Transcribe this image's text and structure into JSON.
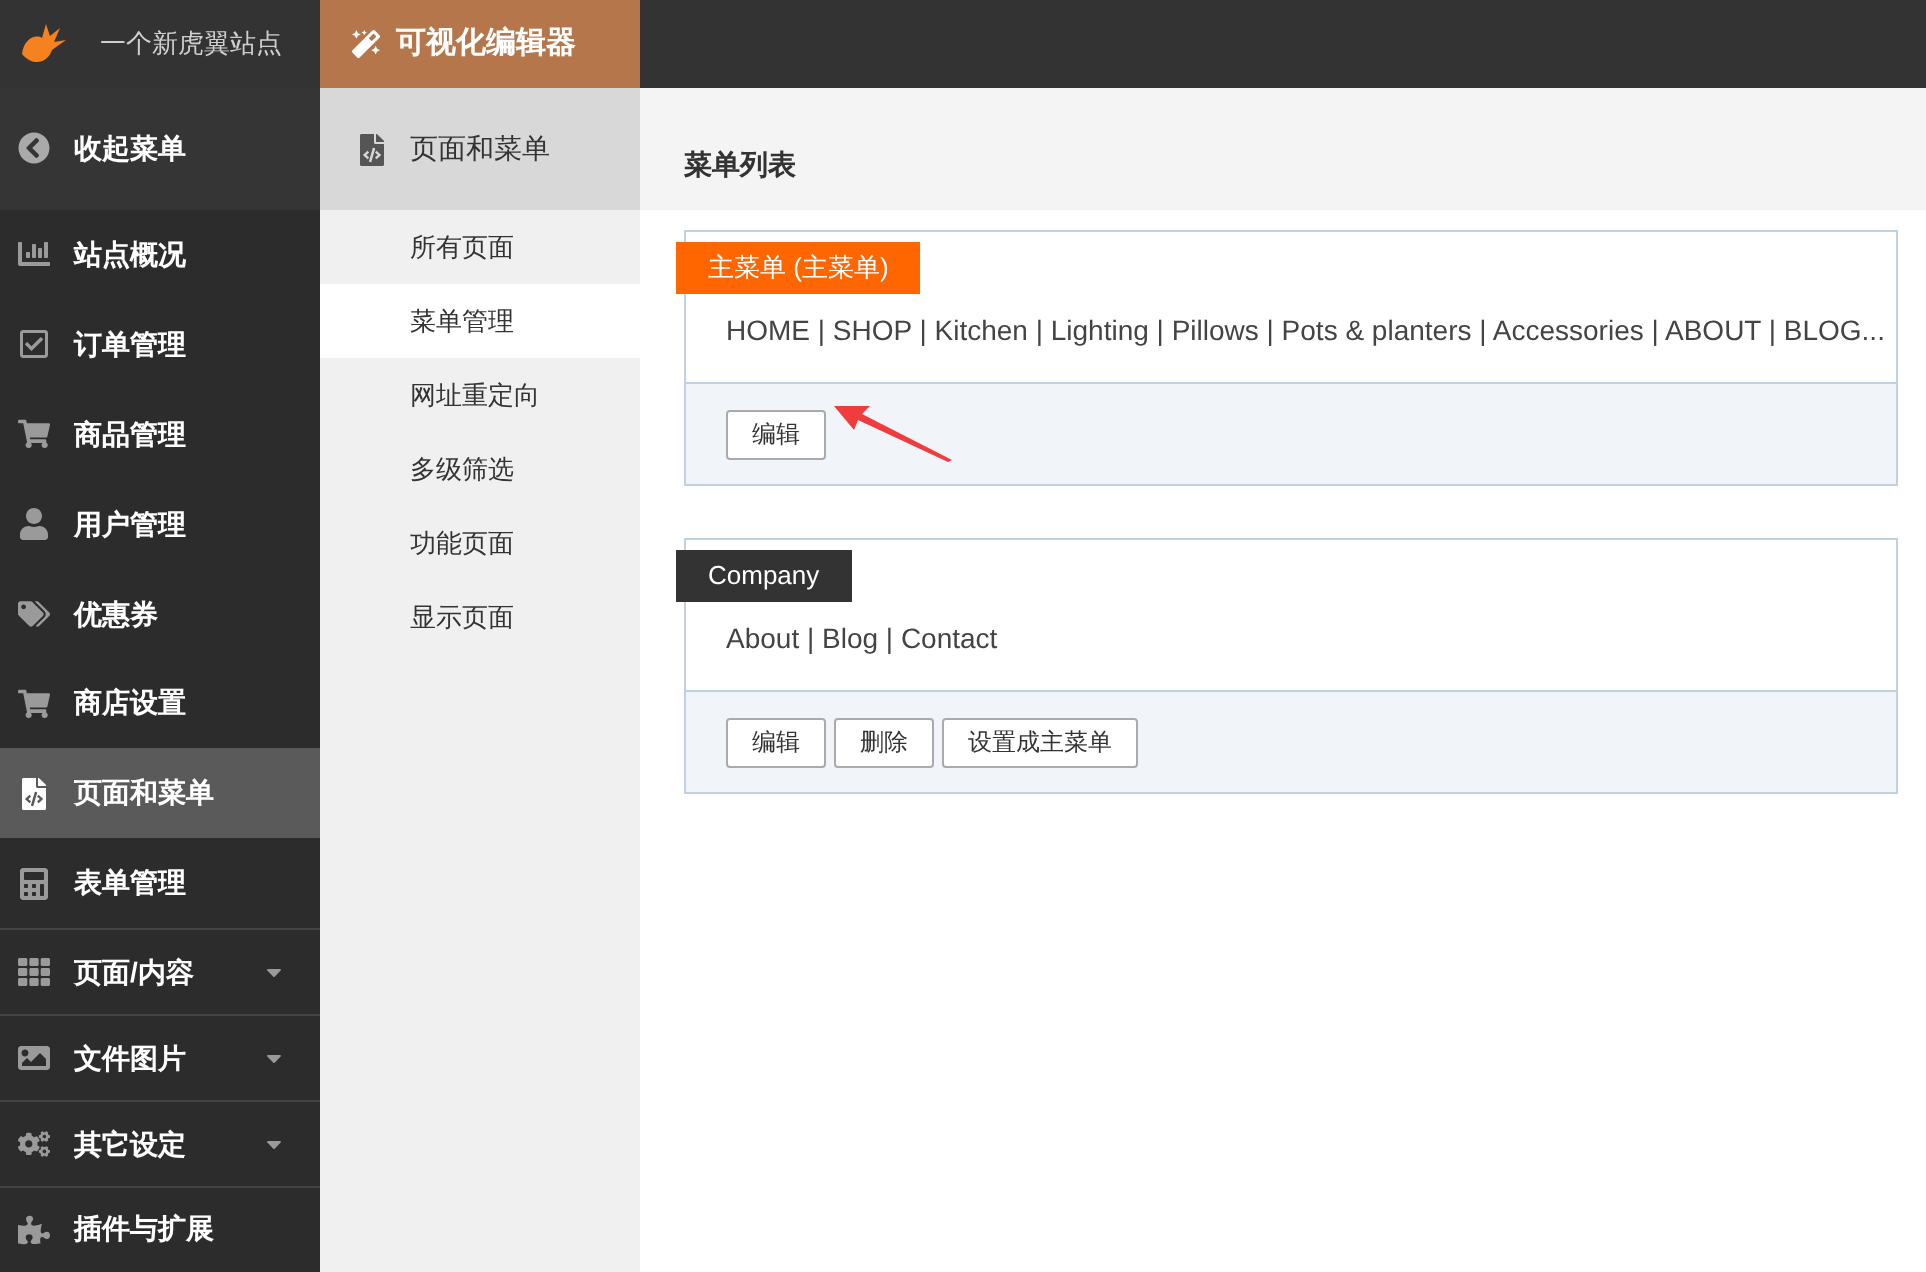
{
  "site": {
    "name": "一个新虎翼站点"
  },
  "top_tab": {
    "label": "可视化编辑器",
    "selected": true
  },
  "collapse": {
    "label": "收起菜单"
  },
  "sidebar": {
    "items": [
      {
        "label": "站点概况",
        "selected": false,
        "expandable": false
      },
      {
        "label": "订单管理",
        "selected": false,
        "expandable": false
      },
      {
        "label": "商品管理",
        "selected": false,
        "expandable": false
      },
      {
        "label": "用户管理",
        "selected": false,
        "expandable": false
      },
      {
        "label": "优惠券",
        "selected": false,
        "expandable": false
      },
      {
        "label": "商店设置",
        "selected": false,
        "expandable": false
      },
      {
        "label": "页面和菜单",
        "selected": true,
        "expandable": false
      },
      {
        "label": "表单管理",
        "selected": false,
        "expandable": false
      },
      {
        "label": "页面/内容",
        "selected": false,
        "expandable": true
      },
      {
        "label": "文件图片",
        "selected": false,
        "expandable": true
      },
      {
        "label": "其它设定",
        "selected": false,
        "expandable": true
      },
      {
        "label": "插件与扩展",
        "selected": false,
        "expandable": false
      }
    ]
  },
  "subnav": {
    "title": "页面和菜单",
    "items": [
      {
        "label": "所有页面",
        "selected": false
      },
      {
        "label": "菜单管理",
        "selected": true
      },
      {
        "label": "网址重定向",
        "selected": false
      },
      {
        "label": "多级筛选",
        "selected": false
      },
      {
        "label": "功能页面",
        "selected": false
      },
      {
        "label": "显示页面",
        "selected": false
      }
    ]
  },
  "main": {
    "title": "菜单列表",
    "menus": [
      {
        "name": "主菜单 (主菜单)",
        "color": "#ff6600",
        "items": "HOME | SHOP | Kitchen | Lighting | Pillows | Pots & planters | Accessories | ABOUT | BLOG...",
        "buttons": [
          "编辑"
        ],
        "pointer": true
      },
      {
        "name": "Company",
        "color": "#333333",
        "items": "About | Blog | Contact",
        "buttons": [
          "编辑",
          "删除",
          "设置成主菜单"
        ],
        "pointer": false
      }
    ]
  }
}
